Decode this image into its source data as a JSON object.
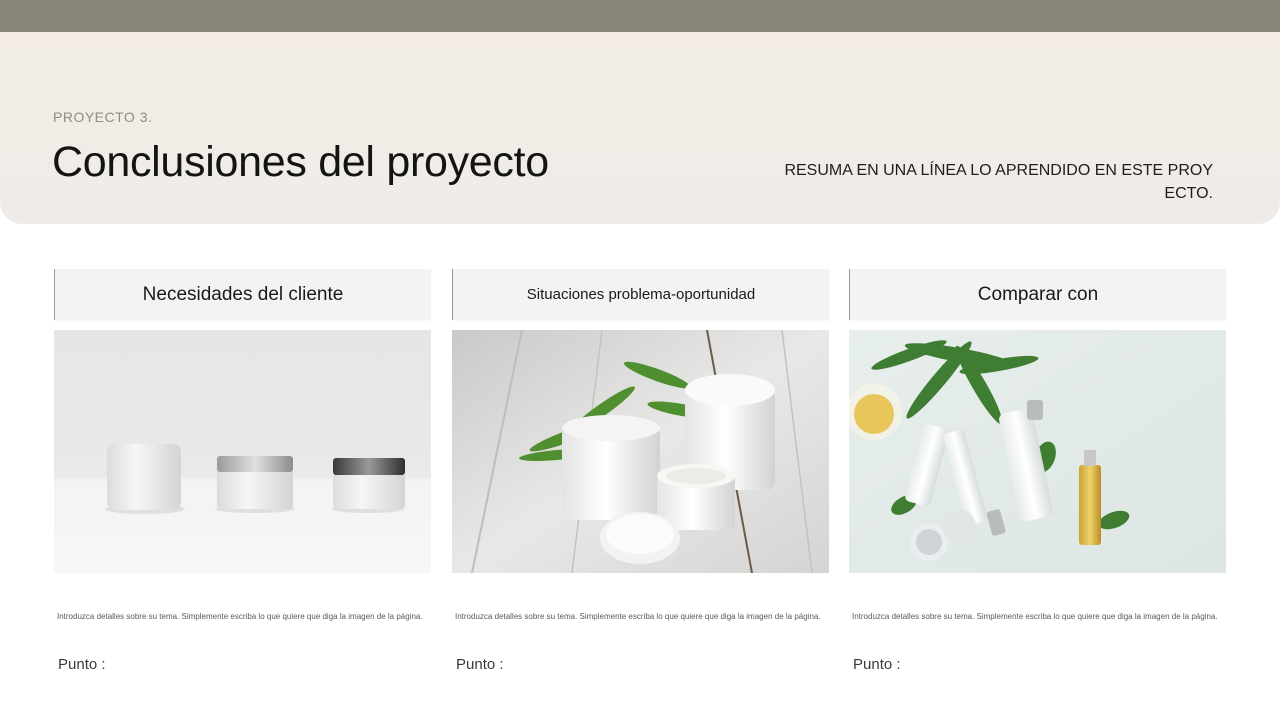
{
  "header": {
    "eyebrow": "PROYECTO 3.",
    "title": "Conclusiones del proyecto",
    "summary": "RESUMA EN UNA LÍNEA LO APRENDIDO EN ESTE PROYECTO."
  },
  "columns": [
    {
      "title": "Necesidades del cliente",
      "image": "white-cosmetic-jars-photo",
      "description": "Introduzca detalles sobre su tema. Simplemente escriba lo que quiere que diga la imagen de la página.",
      "point": "Punto :"
    },
    {
      "title": "Situaciones problema-oportunidad",
      "image": "cream-jars-with-leaves-photo",
      "description": "Introduzca detalles sobre su tema. Simplemente escriba lo que quiere que diga la imagen de la página.",
      "point": "Punto :"
    },
    {
      "title": "Comparar con",
      "image": "skincare-bottles-flatlay-photo",
      "description": "Introduzca detalles sobre su tema. Simplemente escriba lo que quiere que diga la imagen de la página.",
      "point": "Punto :"
    }
  ],
  "colors": {
    "top_bar": "#8a857a",
    "header_bg": "#f0ebe6",
    "column_header_bg": "#f4f2f4"
  }
}
